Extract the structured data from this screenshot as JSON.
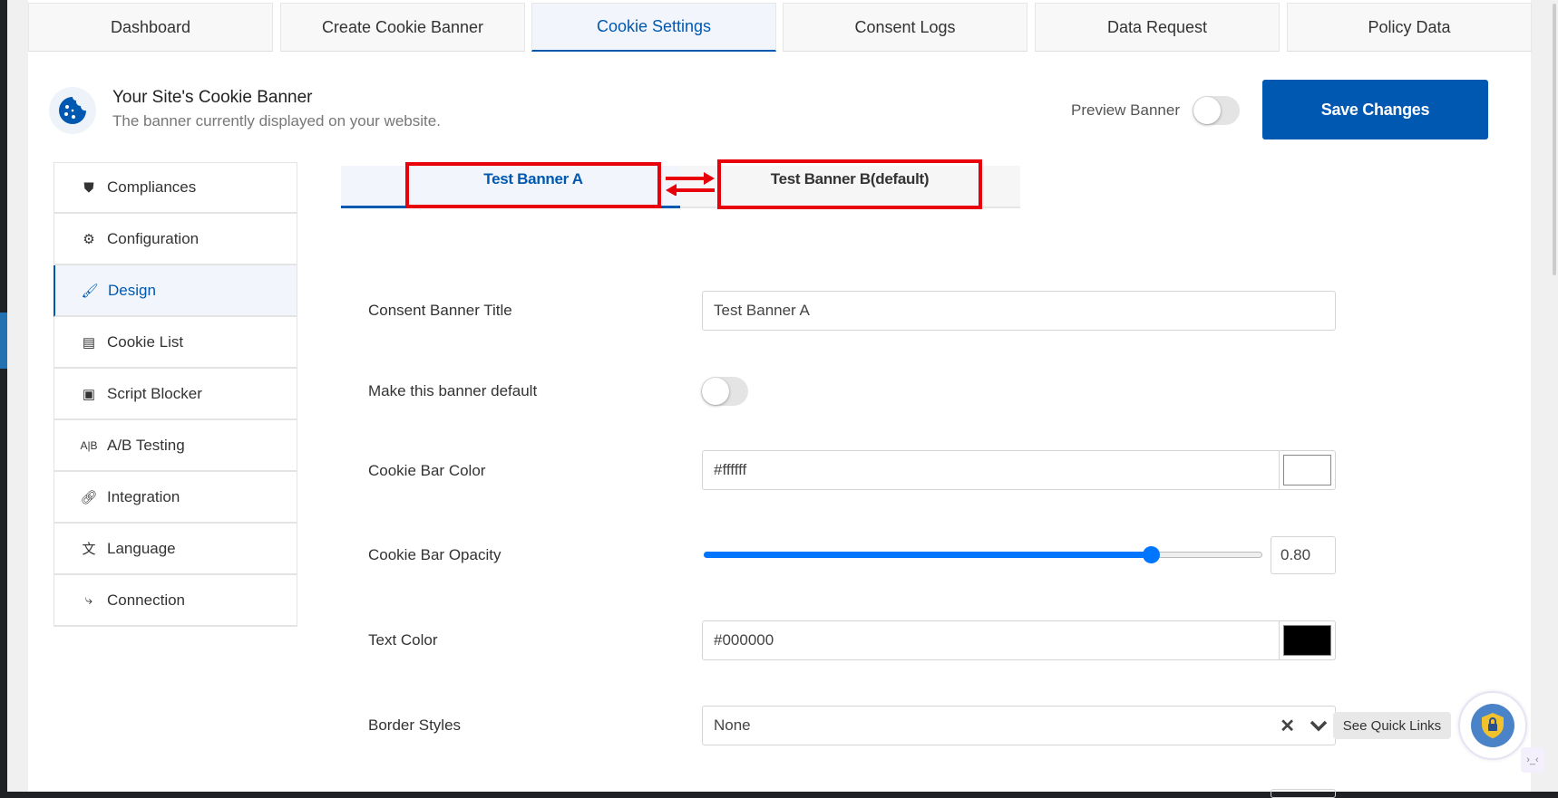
{
  "top_tabs": [
    {
      "label": "Dashboard",
      "active": false
    },
    {
      "label": "Create Cookie Banner",
      "active": false
    },
    {
      "label": "Cookie Settings",
      "active": true
    },
    {
      "label": "Consent Logs",
      "active": false
    },
    {
      "label": "Data Request",
      "active": false
    },
    {
      "label": "Policy Data",
      "active": false
    }
  ],
  "header": {
    "title": "Your Site's Cookie Banner",
    "subtitle": "The banner currently displayed on your website.",
    "preview_label": "Preview Banner",
    "preview_on": false,
    "save_label": "Save Changes"
  },
  "sidebar": {
    "items": [
      {
        "label": "Compliances",
        "icon": "shield-icon"
      },
      {
        "label": "Configuration",
        "icon": "gears-icon"
      },
      {
        "label": "Design",
        "icon": "brush-icon",
        "active": true
      },
      {
        "label": "Cookie List",
        "icon": "scroll-icon"
      },
      {
        "label": "Script Blocker",
        "icon": "script-icon"
      },
      {
        "label": "A/B Testing",
        "icon": "ab-icon"
      },
      {
        "label": "Integration",
        "icon": "link-icon"
      },
      {
        "label": "Language",
        "icon": "translate-icon"
      },
      {
        "label": "Connection",
        "icon": "connection-icon"
      }
    ]
  },
  "banner_tabs": {
    "a": "Test Banner A",
    "b": "Test Banner B(default)"
  },
  "form": {
    "title_label": "Consent Banner Title",
    "title_value": "Test Banner A",
    "default_label": "Make this banner default",
    "default_on": false,
    "bar_color_label": "Cookie Bar Color",
    "bar_color_value": "#ffffff",
    "opacity_label": "Cookie Bar Opacity",
    "opacity_value": "0.80",
    "opacity_fraction": 0.8,
    "text_color_label": "Text Color",
    "text_color_value": "#000000",
    "border_label": "Border Styles",
    "border_value": "None"
  },
  "quick_links": {
    "tooltip": "See Quick Links"
  },
  "colors": {
    "accent": "#0058b0",
    "highlight": "#e8000b",
    "shield": "#f2c12e"
  }
}
